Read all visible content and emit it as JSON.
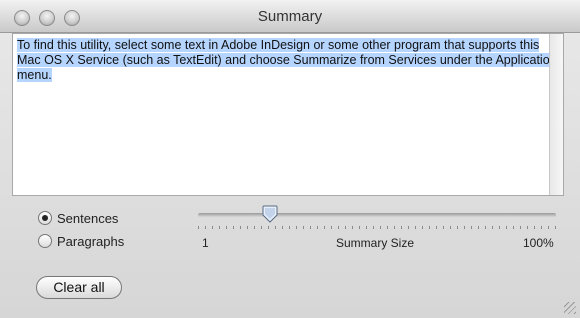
{
  "window": {
    "title": "Summary"
  },
  "summary_text": {
    "content": "To find this utility, select some text in Adobe InDesign or some other program that supports this Mac OS X Service (such as TextEdit) and choose Summarize from Services under the Application menu."
  },
  "summarize_by": {
    "options": [
      {
        "label": "Sentences",
        "selected": true
      },
      {
        "label": "Paragraphs",
        "selected": false
      }
    ]
  },
  "summary_size": {
    "min_label": "1",
    "label": "Summary Size",
    "max_label": "100%",
    "value_fraction": 0.2
  },
  "buttons": {
    "clear_all": "Clear all"
  }
}
